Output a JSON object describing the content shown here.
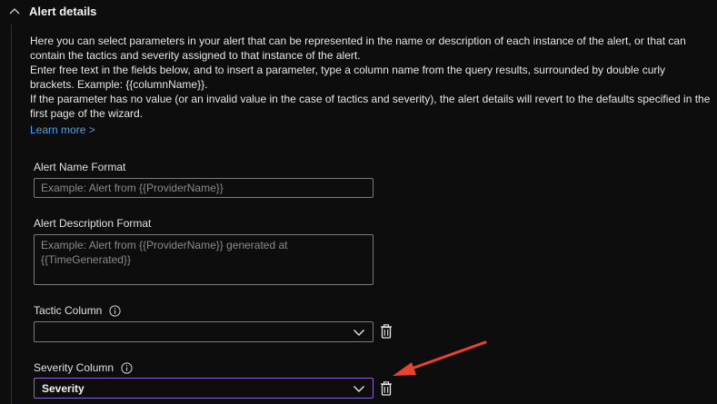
{
  "section": {
    "title": "Alert details",
    "description": [
      "Here you can select parameters in your alert that can be represented in the name or description of each instance of the alert, or that can contain the tactics and severity assigned to that instance of the alert.",
      "Enter free text in the fields below, and to insert a parameter, type a column name from the query results, surrounded by double curly brackets. Example: {{columnName}}.",
      "If the parameter has no value (or an invalid value in the case of tactics and severity), the alert details will revert to the defaults specified in the first page of the wizard."
    ],
    "learn_more": "Learn more >"
  },
  "fields": {
    "alert_name": {
      "label": "Alert Name Format",
      "value": "",
      "placeholder": "Example: Alert from {{ProviderName}}"
    },
    "alert_description": {
      "label": "Alert Description Format",
      "value": "",
      "placeholder": "Example: Alert from {{ProviderName}} generated at {{TimeGenerated}}"
    },
    "tactic_column": {
      "label": "Tactic Column",
      "value": ""
    },
    "severity_column": {
      "label": "Severity Column",
      "value": "Severity"
    }
  },
  "icons": {
    "collapse": "chevron-up-icon",
    "info": "info-icon",
    "dropdown": "chevron-down-icon",
    "delete": "trash-icon",
    "annotation": "red-arrow"
  },
  "colors": {
    "background": "#0d0d0d",
    "link": "#4aa0f0",
    "active_border": "#8a66c9",
    "annotation_arrow": "#e8432e"
  }
}
